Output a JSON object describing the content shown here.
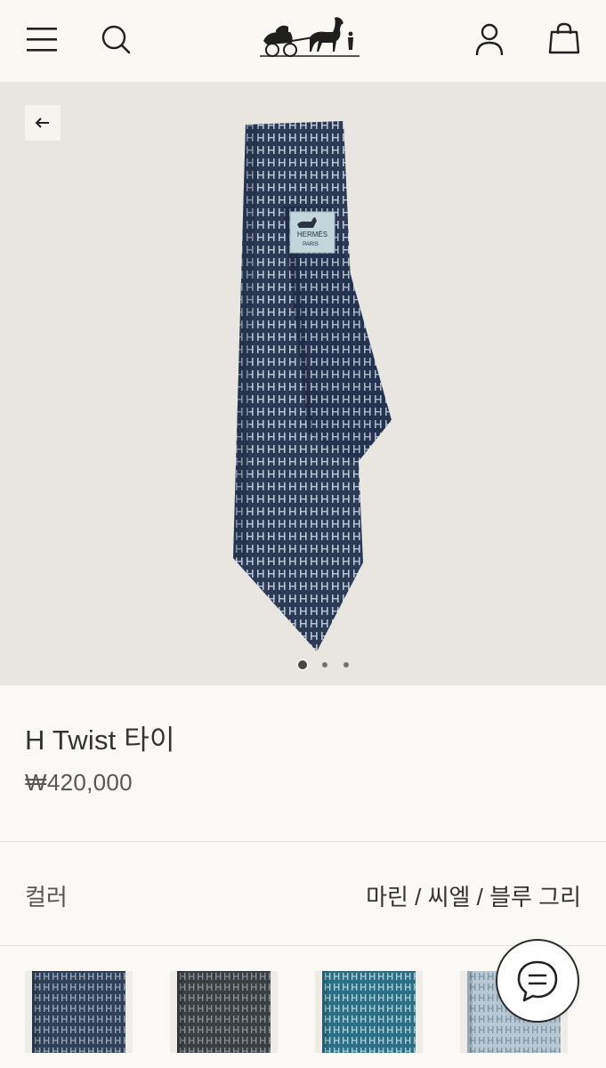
{
  "header": {
    "menu_icon": "hamburger-menu-icon",
    "search_icon": "search-icon",
    "logo_icon": "horse-carriage-logo",
    "account_icon": "person-icon",
    "bag_icon": "shopping-bag-icon"
  },
  "gallery": {
    "back_icon": "arrow-left-icon",
    "label_line1": "HERMÈS",
    "label_line2": "PARIS",
    "current_slide": 1,
    "slide_count": 3
  },
  "product": {
    "title": "H Twist 타이",
    "price": "₩420,000"
  },
  "color": {
    "label": "컬러",
    "value": "마린 / 씨엘 / 블루 그리"
  },
  "swatches": [
    {
      "name": "navy",
      "base": "#2f4057",
      "pattern": "#9aa6b8"
    },
    {
      "name": "charcoal",
      "base": "#3a3f45",
      "pattern": "#8a8f93"
    },
    {
      "name": "teal",
      "base": "#2b6f86",
      "pattern": "#a9cfd8"
    },
    {
      "name": "light-blue",
      "base": "#b8c9d3",
      "pattern": "#7f96a6"
    }
  ],
  "colors": {
    "header_bg": "#fbf8f3",
    "hero_bg": "#e9e5e0",
    "tie_navy": "#2c3a55",
    "tie_pattern": "#b9c4d4"
  },
  "chat_icon": "chat-bubble-icon"
}
